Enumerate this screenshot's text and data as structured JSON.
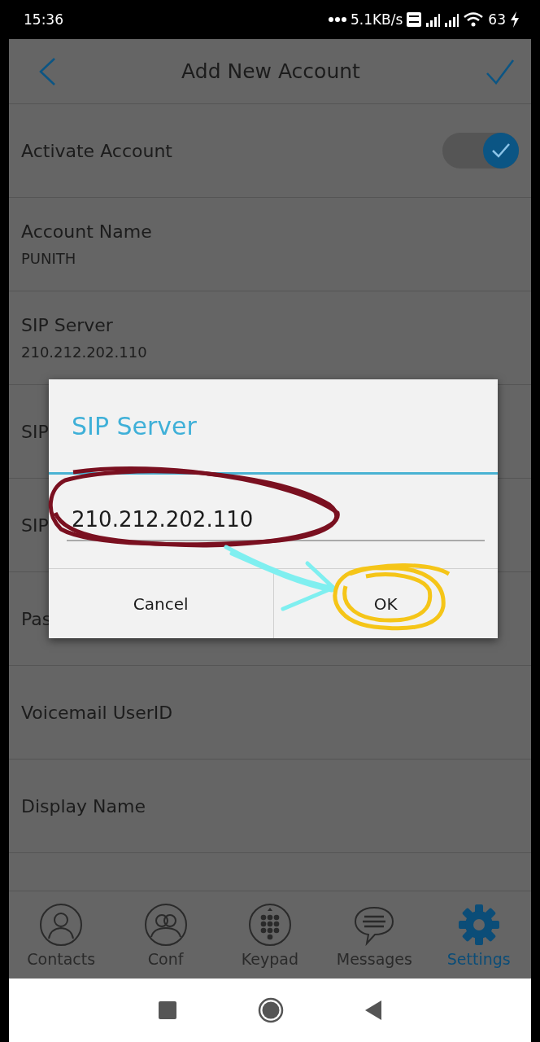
{
  "status_bar": {
    "time": "15:36",
    "network_speed": "5.1KB/s",
    "battery": "63"
  },
  "header": {
    "title": "Add New Account"
  },
  "settings": [
    {
      "kind": "toggle",
      "label": "Activate Account",
      "on": true
    },
    {
      "kind": "field",
      "label": "Account Name",
      "value": "PUNITH"
    },
    {
      "kind": "field",
      "label": "SIP Server",
      "value": "210.212.202.110"
    },
    {
      "kind": "field",
      "label": "SIP"
    },
    {
      "kind": "field",
      "label": "SIP"
    },
    {
      "kind": "field",
      "label": "Pas"
    },
    {
      "kind": "field",
      "label": "Voicemail UserID"
    },
    {
      "kind": "field",
      "label": "Display Name"
    }
  ],
  "dialog": {
    "title": "SIP Server",
    "value": "210.212.202.110",
    "buttons": [
      "Cancel",
      "OK"
    ]
  },
  "tabs": [
    {
      "kind": "contacts",
      "label": "Contacts",
      "selected": false
    },
    {
      "kind": "conf",
      "label": "Conf",
      "selected": false
    },
    {
      "kind": "keypad",
      "label": "Keypad",
      "selected": false
    },
    {
      "kind": "messages",
      "label": "Messages",
      "selected": false
    },
    {
      "kind": "settings",
      "label": "Settings",
      "selected": true
    }
  ]
}
